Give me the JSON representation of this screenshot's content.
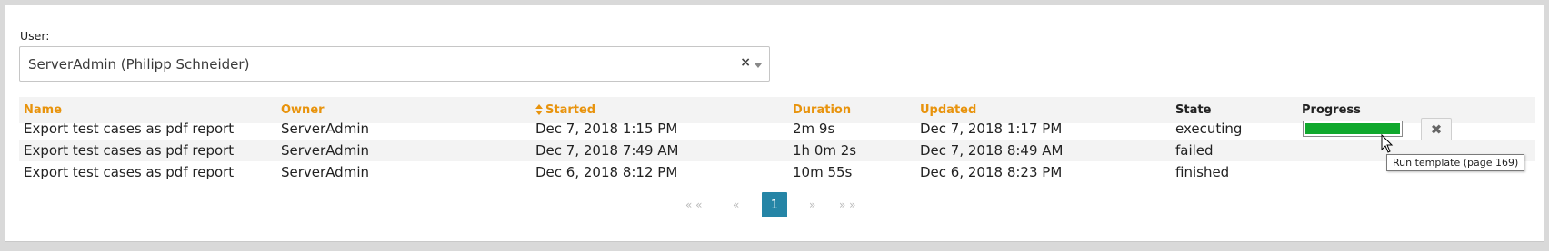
{
  "user_filter": {
    "label": "User:",
    "selected": "ServerAdmin (Philipp Schneider)",
    "clear_glyph": "×"
  },
  "table": {
    "headers": {
      "name": "Name",
      "owner": "Owner",
      "started": "Started",
      "duration": "Duration",
      "updated": "Updated",
      "state": "State",
      "progress": "Progress"
    },
    "sorted_column": "started",
    "rows": [
      {
        "name": "Export test cases as pdf report",
        "owner": "ServerAdmin",
        "started": "Dec 7, 2018 1:15 PM",
        "duration": "2m 9s",
        "updated": "Dec 7, 2018 1:17 PM",
        "state": "executing",
        "progress_percent": 100
      },
      {
        "name": "Export test cases as pdf report",
        "owner": "ServerAdmin",
        "started": "Dec 7, 2018 7:49 AM",
        "duration": "1h 0m 2s",
        "updated": "Dec 7, 2018 8:49 AM",
        "state": "failed"
      },
      {
        "name": "Export test cases as pdf report",
        "owner": "ServerAdmin",
        "started": "Dec 6, 2018 8:12 PM",
        "duration": "10m 55s",
        "updated": "Dec 6, 2018 8:23 PM",
        "state": "finished"
      }
    ]
  },
  "cancel_icon": "close-icon",
  "cancel_glyph": "✖",
  "tooltip": "Run template (page 169)",
  "pagination": {
    "first": "« «",
    "prev": "«",
    "current": "1",
    "next": "»",
    "last": "» »"
  },
  "colors": {
    "header_sortable": "#e8930c",
    "progress_fill": "#10a82d",
    "page_active": "#2585a6"
  }
}
